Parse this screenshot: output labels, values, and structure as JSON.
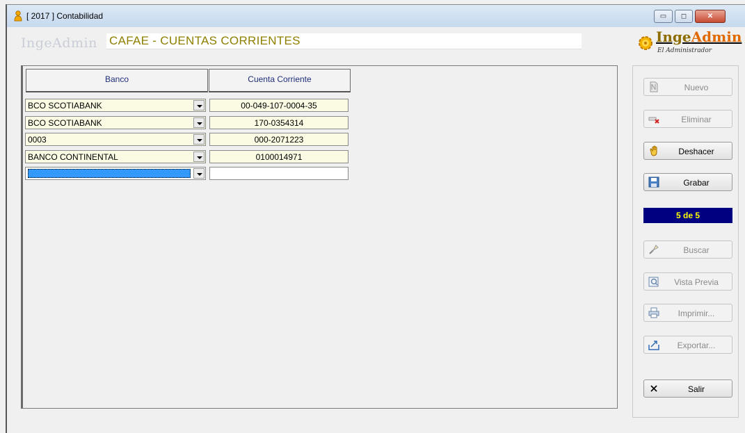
{
  "window": {
    "title": "[ 2017 ] Contabilidad",
    "minimize_glyph": "▭",
    "maximize_glyph": "◻",
    "close_glyph": "✕"
  },
  "header": {
    "faded_logo": "IngeAdmin",
    "title": "CAFAE - CUENTAS CORRIENTES",
    "brand_name_part1": "Inge",
    "brand_name_part2": "Admin",
    "brand_sub": "El Administrador"
  },
  "grid": {
    "columns": [
      "Banco",
      "Cuenta Corriente"
    ],
    "rows": [
      {
        "banco": "BCO SCOTIABANK",
        "cuenta": "00-049-107-0004-35"
      },
      {
        "banco": "BCO SCOTIABANK",
        "cuenta": "170-0354314"
      },
      {
        "banco": "0003",
        "cuenta": "000-2071223"
      },
      {
        "banco": "BANCO CONTINENTAL",
        "cuenta": "0100014971"
      },
      {
        "banco": "",
        "cuenta": ""
      }
    ]
  },
  "sidebar": {
    "nuevo": "Nuevo",
    "eliminar": "Eliminar",
    "deshacer": "Deshacer",
    "grabar": "Grabar",
    "record_counter": "5 de 5",
    "buscar": "Buscar",
    "vista_previa": "Vista Previa",
    "imprimir": "Imprimir...",
    "exportar": "Exportar...",
    "salir": "Salir"
  },
  "colors": {
    "title_text": "#8e7f00",
    "counter_bg": "#000080",
    "counter_text": "#ffff00",
    "cell_bg": "#fbfbe3",
    "selection": "#3399ff"
  }
}
